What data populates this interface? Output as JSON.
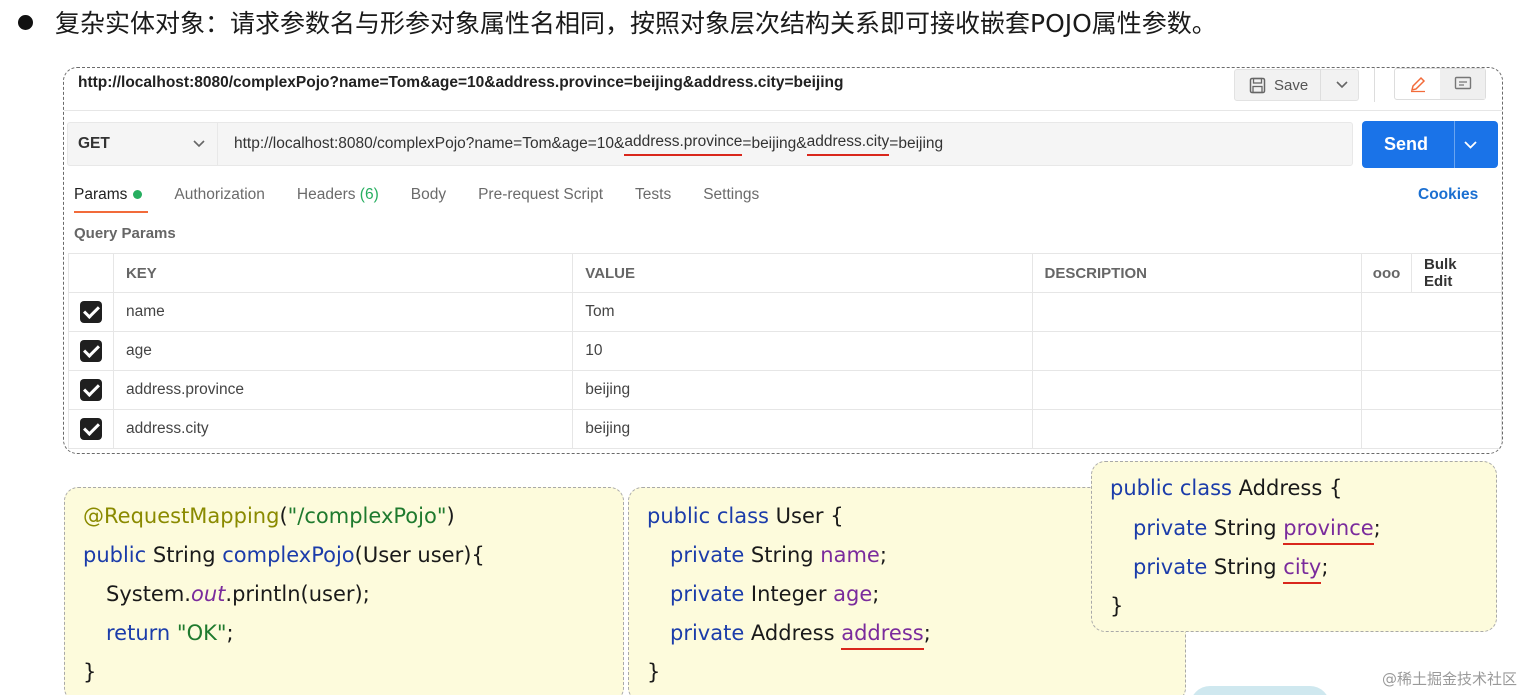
{
  "heading": "复杂实体对象：请求参数名与形参对象属性名相同，按照对象层次结构关系即可接收嵌套POJO属性参数。",
  "postman": {
    "tab_url": "http://localhost:8080/complexPojo?name=Tom&age=10&address.province=beijing&address.city=beijing",
    "save_label": "Save",
    "method": "GET",
    "url": {
      "part1": "http://localhost:8080/complexPojo?name=Tom&age=10&",
      "part2": "address.province",
      "part3": "=beijing&",
      "part4": "address.city",
      "part5": "=beijing"
    },
    "send_label": "Send",
    "tabs": {
      "params": "Params",
      "authorization": "Authorization",
      "headers": "Headers",
      "headers_count": "(6)",
      "body": "Body",
      "prerequest": "Pre-request Script",
      "tests": "Tests",
      "settings": "Settings"
    },
    "cookies_label": "Cookies",
    "query_params_title": "Query Params",
    "columns": {
      "key": "KEY",
      "value": "VALUE",
      "description": "DESCRIPTION",
      "more": "ooo",
      "bulk_edit": "Bulk Edit"
    },
    "params": [
      {
        "key": "name",
        "value": "Tom",
        "checked": true
      },
      {
        "key": "age",
        "value": "10",
        "checked": true
      },
      {
        "key": "address.province",
        "value": "beijing",
        "checked": true
      },
      {
        "key": "address.city",
        "value": "beijing",
        "checked": true
      }
    ]
  },
  "code_controller": {
    "l1_ann": "@RequestMapping",
    "l1_paren_open": "(",
    "l1_str": "\"/complexPojo\"",
    "l1_paren_close": ")",
    "l2_kw": "public",
    "l2_type": " String ",
    "l2_method": "complexPojo",
    "l2_rest": "(User user){",
    "l3_a": "System.",
    "l3_out": "out",
    "l3_b": ".println(user);",
    "l4_kw": "return",
    "l4_str": "\"OK\"",
    "l4_end": ";",
    "l5": "}"
  },
  "code_user": {
    "l1_kw": "public class",
    "l1_rest": " User {",
    "l2_kw": "private",
    "l2_type": " String ",
    "l2_field": "name",
    "l3_kw": "private",
    "l3_type": " Integer ",
    "l3_field": "age",
    "l4_kw": "private",
    "l4_type": " Address ",
    "l4_field": "address",
    "semi": ";",
    "l5": "}"
  },
  "code_address": {
    "l1_kw": "public class",
    "l1_rest": " Address {",
    "l2_kw": "private",
    "l2_type": " String ",
    "l2_field": "province",
    "l3_kw": "private",
    "l3_type": " String ",
    "l3_field": "city",
    "semi": ";",
    "l4": "}"
  },
  "watermark": "@稀土掘金技术社区"
}
